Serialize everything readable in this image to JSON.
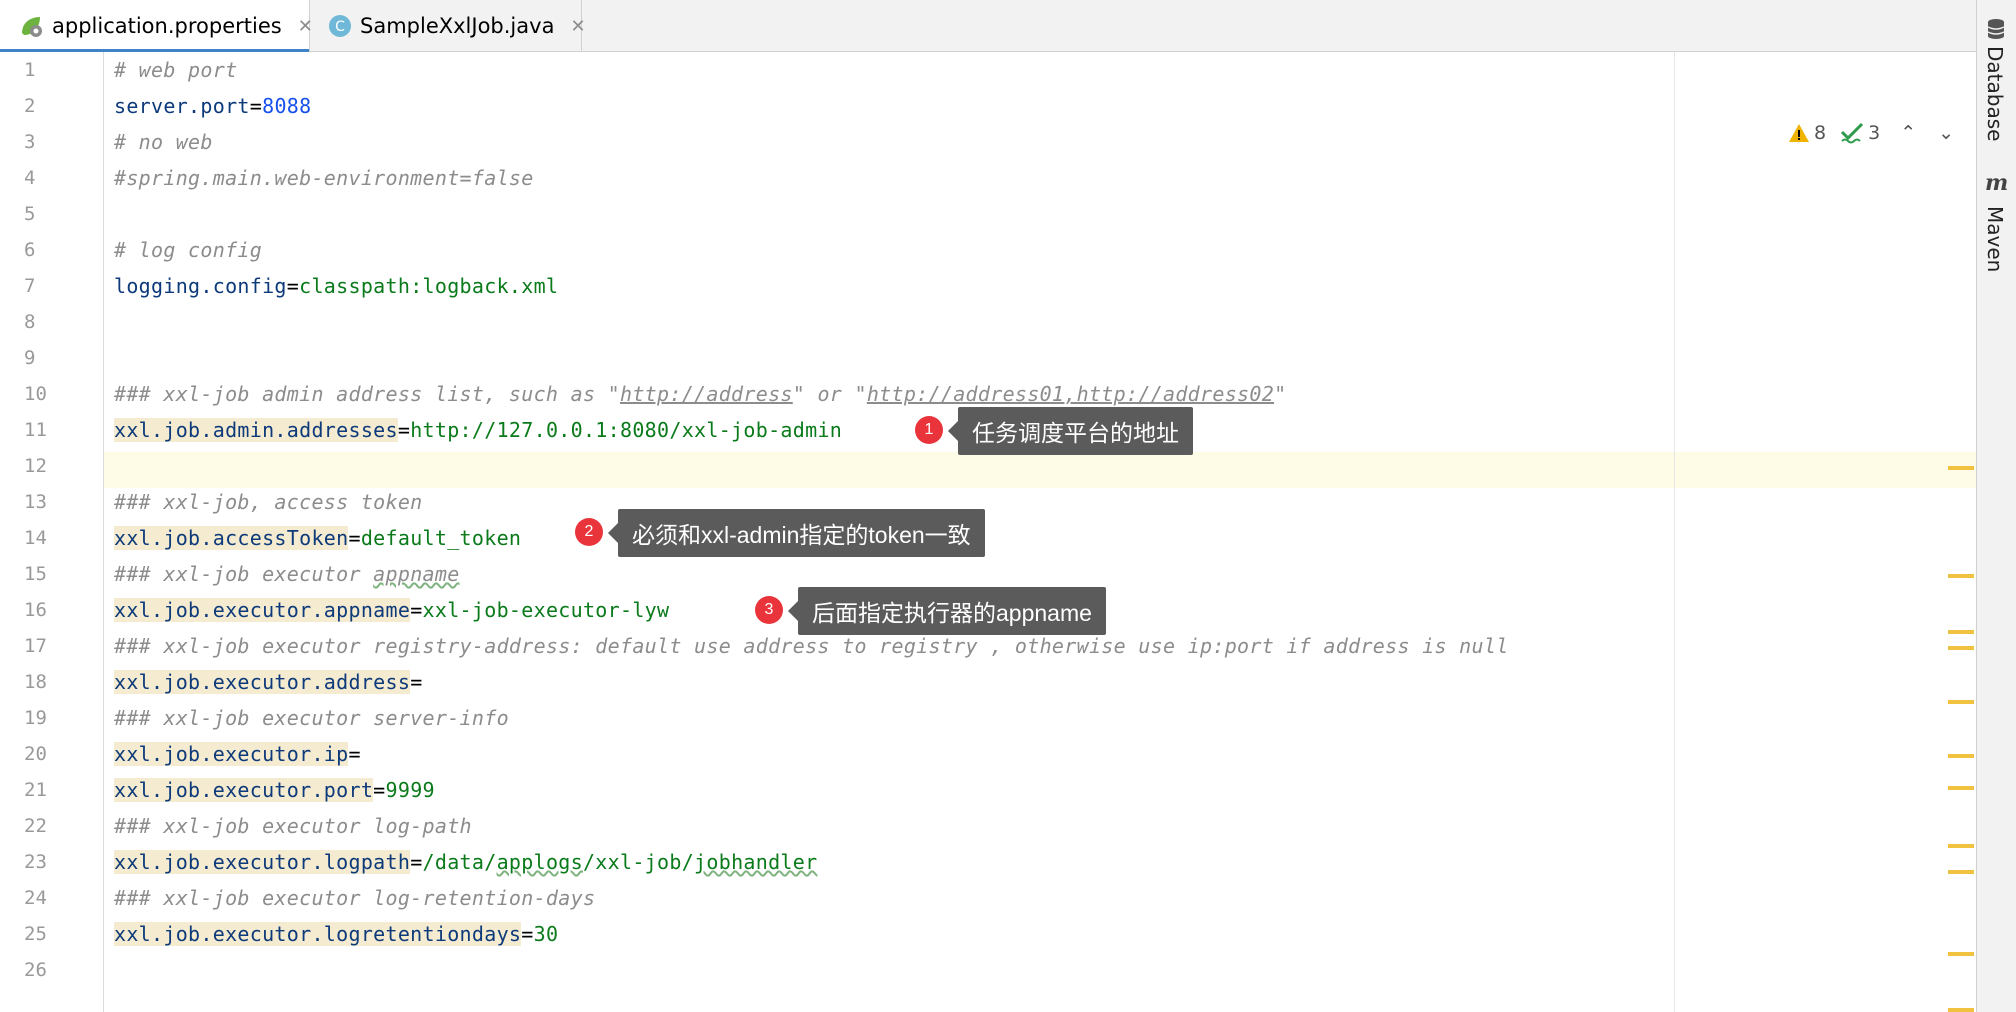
{
  "tabs": [
    {
      "label": "application.properties",
      "icon": "spring-leaf-icon",
      "active": true
    },
    {
      "label": "SampleXxlJob.java",
      "icon": "java-class-icon",
      "active": false
    }
  ],
  "tool_windows": [
    {
      "label": "Database",
      "icon": "database-icon"
    },
    {
      "label": "Maven",
      "icon": "maven-icon",
      "glyph": "m"
    }
  ],
  "inspection": {
    "warnings": "8",
    "typos": "3"
  },
  "code_lines": [
    {
      "n": "1",
      "comment": "# web port"
    },
    {
      "n": "2",
      "key": "server.port",
      "eq": "=",
      "value": "8088",
      "value_type": "num"
    },
    {
      "n": "3",
      "comment": "# no web"
    },
    {
      "n": "4",
      "comment": "#spring.main.web-environment=false"
    },
    {
      "n": "5"
    },
    {
      "n": "6",
      "comment": "# log config"
    },
    {
      "n": "7",
      "key": "logging.config",
      "eq": "=",
      "value": "classpath:logback.xml"
    },
    {
      "n": "8"
    },
    {
      "n": "9"
    },
    {
      "n": "10",
      "comment_parts": [
        "### xxl-job admin address list, such as \"",
        "http://address",
        "\" or \"",
        "http://address01,http://address02",
        "\""
      ]
    },
    {
      "n": "11",
      "key": "xxl.job.admin.addresses",
      "eq": "=",
      "value": "http://127.0.0.1:8080/xxl-job-admin",
      "hl": true
    },
    {
      "n": "12"
    },
    {
      "n": "13",
      "comment": "### xxl-job, access token"
    },
    {
      "n": "14",
      "key": "xxl.job.accessToken",
      "eq": "=",
      "value": "default_token",
      "hl": true
    },
    {
      "n": "15",
      "comment_parts": [
        "### xxl-job executor ",
        "appname"
      ]
    },
    {
      "n": "16",
      "key": "xxl.job.executor.appname",
      "eq": "=",
      "value": "xxl-job-executor-lyw",
      "hl": true
    },
    {
      "n": "17",
      "comment": "### xxl-job executor registry-address: default use address to registry , otherwise use ip:port if address is null"
    },
    {
      "n": "18",
      "key": "xxl.job.executor.address",
      "eq": "=",
      "value": "",
      "hl": true
    },
    {
      "n": "19",
      "comment": "### xxl-job executor server-info"
    },
    {
      "n": "20",
      "key": "xxl.job.executor.ip",
      "eq": "=",
      "value": "",
      "hl": true
    },
    {
      "n": "21",
      "key": "xxl.job.executor.port",
      "eq": "=",
      "value": "9999",
      "hl": true
    },
    {
      "n": "22",
      "comment": "### xxl-job executor log-path"
    },
    {
      "n": "23",
      "key": "xxl.job.executor.logpath",
      "eq": "=",
      "value_parts": [
        "/data/",
        "applogs",
        "/xxl-job/",
        "jobhandler"
      ],
      "hl": true
    },
    {
      "n": "24",
      "comment": "### xxl-job executor log-retention-days"
    },
    {
      "n": "25",
      "key": "xxl.job.executor.logretentiondays",
      "eq": "=",
      "value": "30",
      "hl": true
    },
    {
      "n": "26"
    }
  ],
  "annotations": [
    {
      "num": "1",
      "text": "任务调度平台的地址"
    },
    {
      "num": "2",
      "text": "必须和xxl-admin指定的token一致"
    },
    {
      "num": "3",
      "text": "后面指定执行器的appname"
    }
  ],
  "colors": {
    "accent": "#4083c9",
    "comment": "#8c8c8c",
    "key": "#0d3a7a",
    "value": "#0a7a1a",
    "number": "#1750eb",
    "key_highlight": "#f5ebd0",
    "caret_row": "#fefbe6",
    "badge": "#e8343a",
    "callout": "#5b5b5b",
    "marker": "#f0c240"
  }
}
